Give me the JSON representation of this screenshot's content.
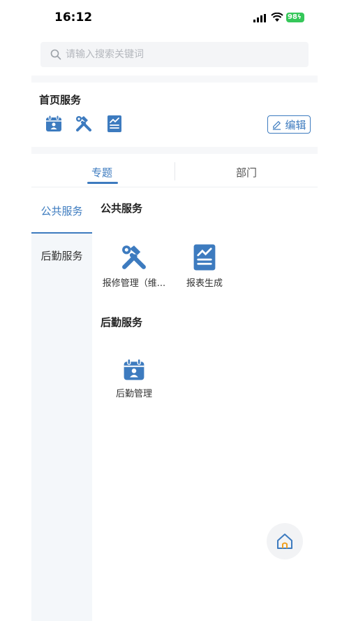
{
  "status_bar": {
    "time": "16:12",
    "battery": "98"
  },
  "search": {
    "placeholder": "请输入搜索关键词"
  },
  "home_services": {
    "title": "首页服务",
    "icons": [
      "calendar-person-icon",
      "tools-icon",
      "report-icon"
    ],
    "edit_label": "编辑"
  },
  "tabs": [
    {
      "label": "专题",
      "active": true
    },
    {
      "label": "部门",
      "active": false
    }
  ],
  "side_menu": [
    {
      "label": "公共服务",
      "active": true
    },
    {
      "label": "后勤服务",
      "active": false
    }
  ],
  "sections": [
    {
      "title": "公共服务",
      "items": [
        {
          "label": "报修管理（维...",
          "icon": "tools-icon"
        },
        {
          "label": "报表生成",
          "icon": "report-icon"
        }
      ]
    },
    {
      "title": "后勤服务",
      "items": [
        {
          "label": "后勤管理",
          "icon": "calendar-person-icon"
        }
      ]
    }
  ],
  "colors": {
    "accent": "#3d7bbf",
    "battery": "#35c759"
  }
}
